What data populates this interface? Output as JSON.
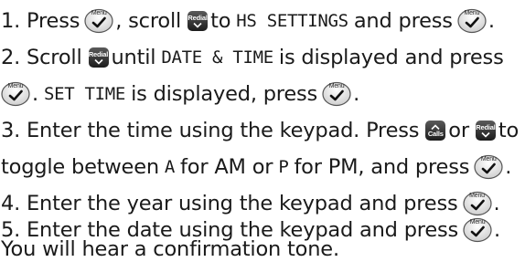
{
  "keys": {
    "menu_caption": "Menu",
    "redial_caption": "Redial",
    "calls_caption": "Calls"
  },
  "step1": {
    "a": "1. Press",
    "b": ", scroll",
    "c": "to",
    "lcd": "HS SETTINGS",
    "d": "and press",
    "e": "."
  },
  "step2": {
    "a": "2. Scroll",
    "b": "until",
    "lcd1": "DATE & TIME",
    "c": "is displayed and press",
    "d": ".",
    "lcd2": "SET TIME",
    "e": "is displayed, press",
    "f": "."
  },
  "step3": {
    "a": "3. Enter the time using the keypad. Press",
    "b": "or",
    "c": "to",
    "d": "toggle between",
    "lcd_a": "A",
    "e": "for AM or",
    "lcd_p": "P",
    "f": "for PM, and press",
    "g": "."
  },
  "step4": {
    "a": "4. Enter the year using the keypad and press",
    "b": "."
  },
  "step5": {
    "a": "5. Enter the date using the keypad and press",
    "b": "."
  },
  "footer": "You will hear a confirmation tone."
}
